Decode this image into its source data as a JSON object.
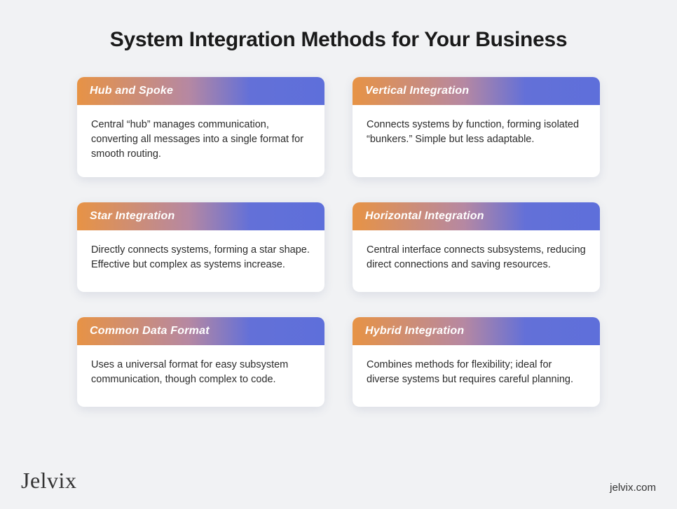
{
  "title": "System Integration Methods for Your Business",
  "cards": [
    {
      "heading": "Hub and Spoke",
      "body": "Central “hub” manages communication, converting all messages into a single format for smooth routing."
    },
    {
      "heading": "Vertical Integration",
      "body": "Connects systems by function, forming isolated “bunkers.” Simple but less adaptable."
    },
    {
      "heading": "Star Integration",
      "body": "Directly connects systems, forming a star shape. Effective but complex as systems increase."
    },
    {
      "heading": "Horizontal Integration",
      "body": "Central interface connects subsystems, reducing direct connections and saving resources."
    },
    {
      "heading": "Common Data Format",
      "body": "Uses a universal format for easy subsystem communication, though complex to code."
    },
    {
      "heading": "Hybrid Integration",
      "body": "Combines methods for flexibility; ideal for diverse systems but requires careful planning."
    }
  ],
  "footer": {
    "brand": "Jelvix",
    "url": "jelvix.com"
  }
}
